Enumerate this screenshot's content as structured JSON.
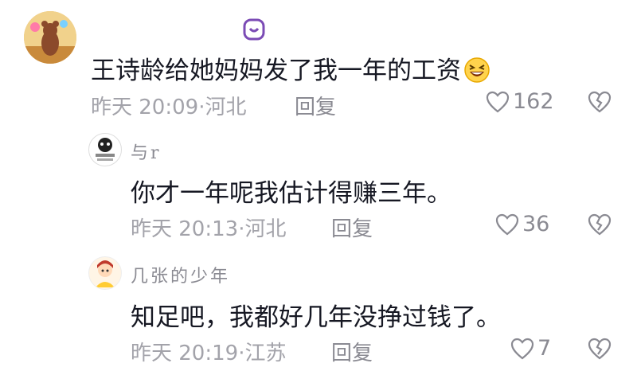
{
  "comments": [
    {
      "username": "",
      "text": "王诗龄给她妈妈发了我一年的工资",
      "emoji": "grinning-squinting-emoji",
      "time": "昨天 20:09·河北",
      "reply": "回复",
      "likes": "162"
    },
    {
      "username": "与r",
      "text": "你才一年呢我估计得赚三年。",
      "time": "昨天 20:13·河北",
      "reply": "回复",
      "likes": "36"
    },
    {
      "username": "几张的少年",
      "text": "知足吧，我都好几年没挣过钱了。",
      "time": "昨天 20:19·江苏",
      "reply": "回复",
      "likes": "7"
    }
  ],
  "icons": {
    "like": "heart-outline-icon",
    "dislike": "heart-broken-icon"
  },
  "colors": {
    "text": "#161823",
    "meta": "#a3a3aa",
    "icon": "#8a8a92",
    "badge": "#7b4bb5"
  }
}
